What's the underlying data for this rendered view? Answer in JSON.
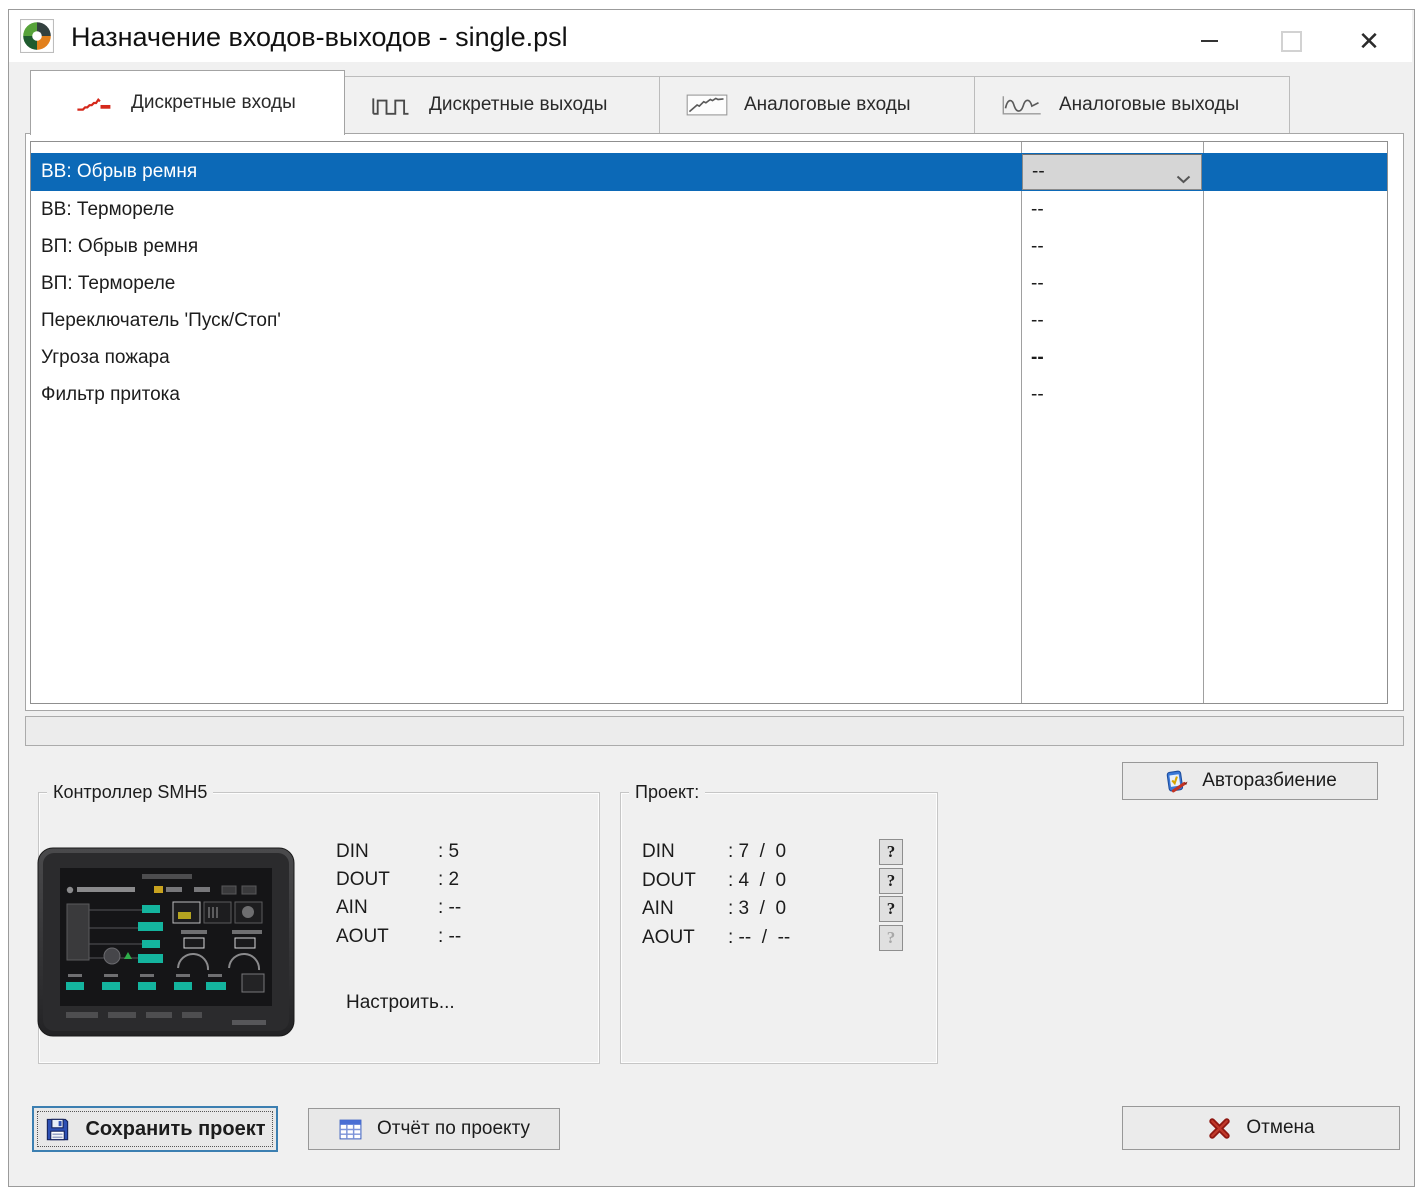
{
  "window": {
    "title": "Назначение входов-выходов - single.psl",
    "controls": {
      "minimize": "minimize",
      "maximize": "maximize (disabled)",
      "close": "close"
    }
  },
  "colors": {
    "selection_blue": "#0c69b7",
    "window_bg": "#f0f0f0",
    "save_focus_border": "#3c7fb1",
    "tab_step_icon_red": "#d5281b",
    "cancel_x_red": "#a01a10"
  },
  "icons": {
    "app": "segnetics-pinwheel-logo",
    "tab_discrete_inputs": "red-step-signal-icon",
    "tab_discrete_outputs": "square-wave-icon",
    "tab_analog_inputs": "analog-ramp-chart-icon",
    "tab_analog_outputs": "sine-wave-chart-icon",
    "combo": "chevron-down-icon",
    "autosplit": "device-with-pen-icon",
    "save": "floppy-disk-icon",
    "report": "table-grid-icon",
    "cancel": "red-x-icon",
    "help": "question-mark-button"
  },
  "tabs": [
    {
      "label": "Дискретные входы",
      "active": true
    },
    {
      "label": "Дискретные выходы",
      "active": false
    },
    {
      "label": "Аналоговые входы",
      "active": false
    },
    {
      "label": "Аналоговые выходы",
      "active": false
    }
  ],
  "signal_table": {
    "rows": [
      {
        "name": "ВВ: Обрыв ремня",
        "value": "--",
        "selected": true,
        "editor": "combobox"
      },
      {
        "name": "ВВ: Термореле",
        "value": "--"
      },
      {
        "name": "ВП: Обрыв ремня",
        "value": "--"
      },
      {
        "name": "ВП: Термореле",
        "value": "--"
      },
      {
        "name": "Переключатель 'Пуск/Стоп'",
        "value": "--"
      },
      {
        "name": "Угроза пожара",
        "value": "--",
        "value_bold": true
      },
      {
        "name": "Фильтр притока",
        "value": "--"
      }
    ]
  },
  "autosplit_button": {
    "label": "Авторазбиение"
  },
  "controller_group": {
    "title": "Контроллер SMH5",
    "stats": [
      {
        "label": "DIN",
        "value": ": 5"
      },
      {
        "label": "DOUT",
        "value": ": 2"
      },
      {
        "label": "AIN",
        "value": ": --"
      },
      {
        "label": "AOUT",
        "value": ": --"
      }
    ],
    "configure_label": "Настроить..."
  },
  "project_group": {
    "title": "Проект:",
    "stats": [
      {
        "label": "DIN",
        "value": ": 7  /  0",
        "help_label": "?",
        "help_enabled": true
      },
      {
        "label": "DOUT",
        "value": ": 4  /  0",
        "help_label": "?",
        "help_enabled": true
      },
      {
        "label": "AIN",
        "value": ": 3  /  0",
        "help_label": "?",
        "help_enabled": true
      },
      {
        "label": "AOUT",
        "value": ": --  /  --",
        "help_label": "?",
        "help_enabled": false
      }
    ]
  },
  "footer": {
    "save_label": "Сохранить проект",
    "report_label": "Отчёт по проекту",
    "cancel_label": "Отмена"
  }
}
